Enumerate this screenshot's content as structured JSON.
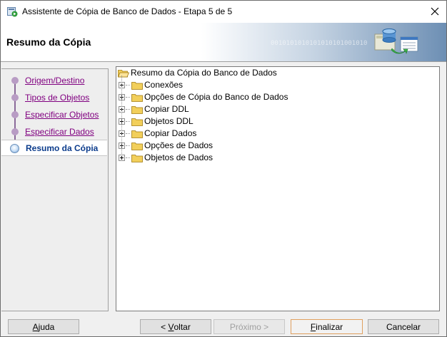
{
  "window": {
    "title": "Assistente de Cópia de Banco de Dados - Etapa 5 de 5"
  },
  "header": {
    "title": "Resumo da Cópia",
    "binary": "0010101010101010101001010"
  },
  "nav": {
    "steps": [
      {
        "label": "Origem/Destino",
        "state": "visited"
      },
      {
        "label": "Tipos de Objetos",
        "state": "visited"
      },
      {
        "label": "Especificar Objetos",
        "state": "visited"
      },
      {
        "label": "Especificar Dados",
        "state": "visited"
      },
      {
        "label": "Resumo da Cópia",
        "state": "current"
      }
    ]
  },
  "tree": {
    "root": "Resumo da Cópia do Banco de Dados",
    "children": [
      "Conexões",
      "Opções de Cópia do Banco de Dados",
      "Copiar DDL",
      "Objetos DDL",
      "Copiar Dados",
      "Opções de Dados",
      "Objetos de Dados"
    ]
  },
  "buttons": {
    "help": {
      "pre": "",
      "mnemonic": "A",
      "post": "juda"
    },
    "back": {
      "pre": "< ",
      "mnemonic": "V",
      "post": "oltar"
    },
    "next": {
      "pre": "Próximo >",
      "mnemonic": "",
      "post": ""
    },
    "finish": {
      "pre": "",
      "mnemonic": "F",
      "post": "inalizar"
    },
    "cancel": {
      "pre": "Cancelar",
      "mnemonic": "",
      "post": ""
    }
  },
  "colors": {
    "visited_link": "#800080",
    "current_step": "#0c3c8c",
    "folder": "#f2cf5b"
  }
}
